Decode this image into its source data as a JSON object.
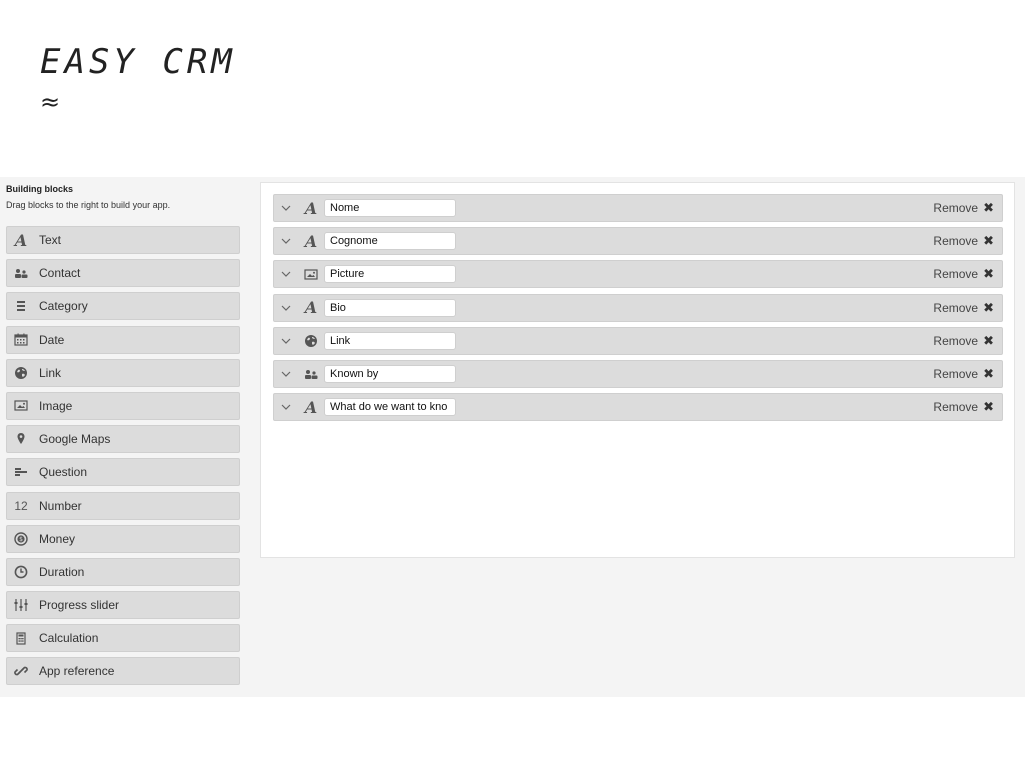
{
  "brand": {
    "title": "EASY CRM",
    "mark": "≈"
  },
  "sidebar": {
    "title": "Building blocks",
    "subtitle": "Drag blocks to the right to build your app.",
    "blocks": [
      {
        "label": "Text",
        "icon": "text-icon"
      },
      {
        "label": "Contact",
        "icon": "contact-icon"
      },
      {
        "label": "Category",
        "icon": "category-icon"
      },
      {
        "label": "Date",
        "icon": "calendar-icon"
      },
      {
        "label": "Link",
        "icon": "globe-icon"
      },
      {
        "label": "Image",
        "icon": "image-icon"
      },
      {
        "label": "Google Maps",
        "icon": "map-pin-icon"
      },
      {
        "label": "Question",
        "icon": "question-icon"
      },
      {
        "label": "Number",
        "icon": "number-icon",
        "glyph": "12"
      },
      {
        "label": "Money",
        "icon": "money-icon"
      },
      {
        "label": "Duration",
        "icon": "clock-icon"
      },
      {
        "label": "Progress slider",
        "icon": "slider-icon"
      },
      {
        "label": "Calculation",
        "icon": "calculator-icon"
      },
      {
        "label": "App reference",
        "icon": "chain-link-icon"
      }
    ]
  },
  "canvas": {
    "fields": [
      {
        "name": "Nome",
        "icon": "text-icon",
        "remove_label": "Remove"
      },
      {
        "name": "Cognome",
        "icon": "text-icon",
        "remove_label": "Remove"
      },
      {
        "name": "Picture",
        "icon": "image-icon",
        "remove_label": "Remove"
      },
      {
        "name": "Bio",
        "icon": "text-icon",
        "remove_label": "Remove"
      },
      {
        "name": "Link",
        "icon": "globe-icon",
        "remove_label": "Remove"
      },
      {
        "name": "Known by",
        "icon": "contact-icon",
        "remove_label": "Remove"
      },
      {
        "name": "What do we want to kno",
        "icon": "text-icon",
        "remove_label": "Remove"
      }
    ],
    "remove_glyph": "✖",
    "chevron_glyph": "﹀"
  }
}
